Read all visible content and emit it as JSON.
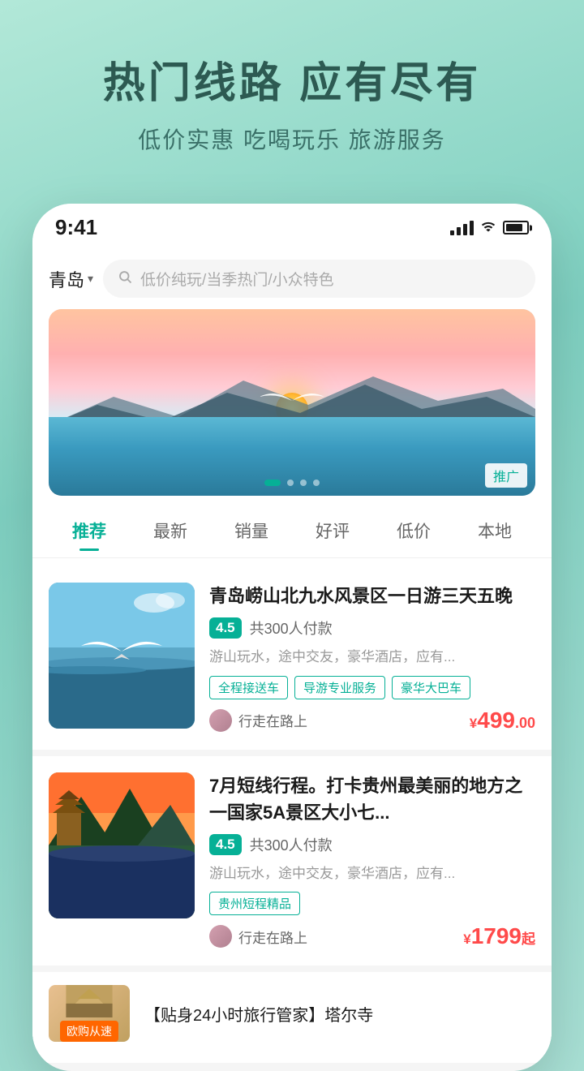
{
  "hero": {
    "title": "热门线路 应有尽有",
    "subtitle": "低价实惠 吃喝玩乐 旅游服务"
  },
  "statusBar": {
    "time": "9:41"
  },
  "searchBar": {
    "location": "青岛",
    "placeholder": "低价纯玩/当季热门/小众特色"
  },
  "banner": {
    "promotedLabel": "推广",
    "dots": [
      true,
      false,
      false,
      false
    ]
  },
  "tabs": [
    {
      "label": "推荐",
      "active": true
    },
    {
      "label": "最新",
      "active": false
    },
    {
      "label": "销量",
      "active": false
    },
    {
      "label": "好评",
      "active": false
    },
    {
      "label": "低价",
      "active": false
    },
    {
      "label": "本地",
      "active": false
    }
  ],
  "products": [
    {
      "title": "青岛崂山北九水风景区一日游三天五晚",
      "rating": "4.5",
      "ratingCount": "共300人付款",
      "description": "游山玩水，途中交友，豪华酒店，应有...",
      "tags": [
        "全程接送车",
        "导游专业服务",
        "豪华大巴车"
      ],
      "seller": "行走在路上",
      "price": "¥",
      "priceMain": "499",
      "priceDecimal": ".00",
      "priceFrom": ""
    },
    {
      "title": "7月短线行程。打卡贵州最美丽的地方之一国家5A景区大小七...",
      "rating": "4.5",
      "ratingCount": "共300人付款",
      "description": "游山玩水，途中交友，豪华酒店，应有...",
      "tags": [
        "贵州短程精品"
      ],
      "seller": "行走在路上",
      "price": "¥",
      "priceMain": "1799",
      "priceDecimal": "",
      "priceFrom": "起"
    }
  ],
  "thirdCard": {
    "badge": "欧购从速",
    "title": "【贴身24小时旅行管家】塔尔寺"
  }
}
